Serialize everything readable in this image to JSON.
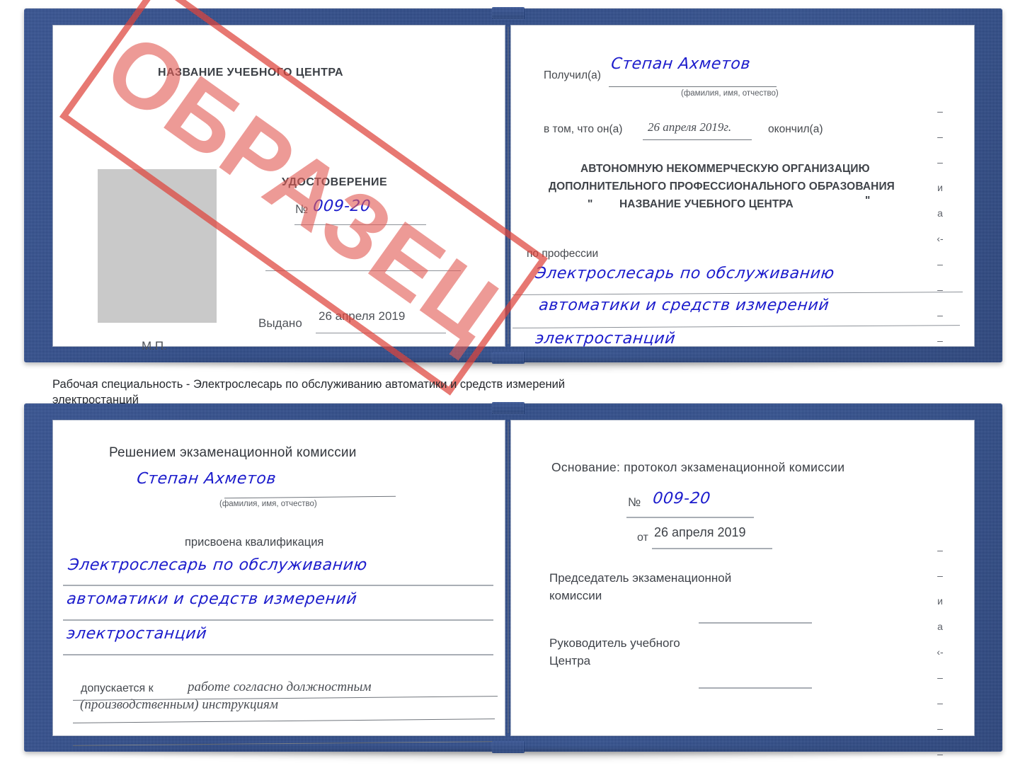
{
  "document": {
    "kind": "certificate-sample-scan",
    "stamp": {
      "text": "ОБРАЗЕЦ",
      "color": "#de443c"
    },
    "ink_color": "#1c1ccc"
  },
  "certificate_top": {
    "left_page": {
      "center_title": "НАЗВАНИЕ УЧЕБНОГО ЦЕНТРА",
      "doc_type": "УДОСТОВЕРЕНИЕ",
      "number_label": "№",
      "number_value": "009-20",
      "issued_label": "Выдано",
      "issued_value": "26 апреля 2019",
      "seal_label": "М.П.",
      "photo_placeholder": "photo-area"
    },
    "right_page": {
      "received_label": "Получил(а)",
      "received_value": "Степан Ахметов",
      "fio_hint": "(фамилия, имя, отчество)",
      "that_he_label": "в том, что он(а)",
      "completion_date": "26 апреля 2019г.",
      "finished_label": "окончил(а)",
      "org_line1": "АВТОНОМНУЮ НЕКОММЕРЧЕСКУЮ ОРГАНИЗАЦИЮ",
      "org_line2": "ДОПОЛНИТЕЛЬНОГО ПРОФЕССИОНАЛЬНОГО ОБРАЗОВАНИЯ",
      "org_quote_open": "\"",
      "org_line3": "НАЗВАНИЕ УЧЕБНОГО ЦЕНТРА",
      "org_quote_close": "\"",
      "profession_label": "по профессии",
      "profession_line1": "Электрослесарь по обслуживанию",
      "profession_line2": "автоматики и средств измерений",
      "profession_line3": "электростанций",
      "margin_glyphs": [
        "–",
        "–",
        "–",
        "и",
        "а",
        "‹-",
        "–",
        "–",
        "–",
        "–"
      ]
    }
  },
  "caption": {
    "line1": "Рабочая специальность - Электрослесарь по обслуживанию автоматики и средств измерений",
    "line2": "электростанций"
  },
  "certificate_bottom": {
    "left_page": {
      "commission_title": "Решением экзаменационной комиссии",
      "name_value": "Степан Ахметов",
      "fio_hint": "(фамилия, имя, отчество)",
      "qualification_label": "присвоена квалификация",
      "qualification_line1": "Электрослесарь по обслуживанию",
      "qualification_line2": "автоматики и средств измерений",
      "qualification_line3": "электростанций",
      "admitted_label": "допускается к",
      "admitted_value_line1": "работе согласно должностным",
      "admitted_value_line2": "(производственным) инструкциям"
    },
    "right_page": {
      "basis_label": "Основание: протокол экзаменационной комиссии",
      "number_label": "№",
      "number_value": "009-20",
      "date_label": "от",
      "date_value": "26 апреля 2019",
      "chairman_line1": "Председатель экзаменационной",
      "chairman_line2": "комиссии",
      "head_line1": "Руководитель учебного",
      "head_line2": "Центра",
      "margin_glyphs": [
        "–",
        "–",
        "и",
        "а",
        "‹-",
        "–",
        "–",
        "–",
        "–"
      ]
    }
  }
}
